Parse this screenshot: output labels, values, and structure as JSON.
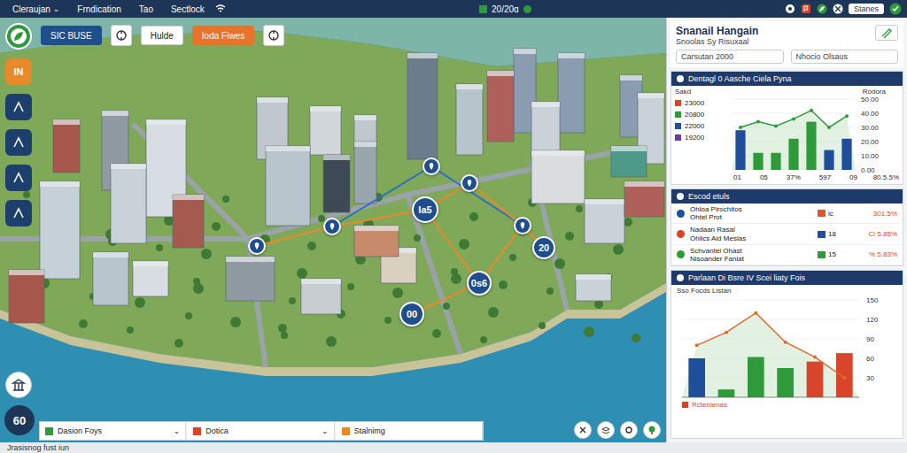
{
  "top_bar": {
    "menus": [
      {
        "label": "Cleraujan",
        "icon": "⌄"
      },
      {
        "label": "Frndication"
      },
      {
        "label": "Tao"
      },
      {
        "label": "Sectlock"
      }
    ],
    "date": "20/20ɑ",
    "user": "Stanes"
  },
  "map_toolbar": [
    {
      "kind": "primary",
      "label": "SIC BUSE"
    },
    {
      "kind": "icon"
    },
    {
      "kind": "plain",
      "label": "Hulde"
    },
    {
      "kind": "accent",
      "label": "Ioda Fiwes"
    },
    {
      "kind": "icon"
    }
  ],
  "left_tools": [
    {
      "kind": "icon"
    },
    {
      "kind": "text",
      "label": "IN"
    },
    {
      "kind": "icon"
    },
    {
      "kind": "icon"
    },
    {
      "kind": "icon"
    },
    {
      "kind": "icon"
    }
  ],
  "markers": [
    {
      "kind": "text",
      "label": "Ia5"
    },
    {
      "kind": "text",
      "label": "20"
    },
    {
      "kind": "text",
      "label": "0s6"
    },
    {
      "kind": "text",
      "label": "00"
    },
    {
      "kind": "icon"
    },
    {
      "kind": "icon"
    },
    {
      "kind": "icon"
    },
    {
      "kind": "icon"
    },
    {
      "kind": "icon"
    }
  ],
  "zoom_badge": "60",
  "bottom_bar": [
    {
      "label": "Dasion Foys",
      "icon": "⌄"
    },
    {
      "label": "Dotica",
      "icon": "⌄"
    },
    {
      "label": "Stalnimg"
    }
  ],
  "status_bar": "Jrasisnog fust iun",
  "panel": {
    "title": "Snanail Hangain",
    "subtitle": "Snoolas Sy Risuxaal",
    "fields": [
      "Carsutan 2000",
      "Nhocio Olsaus"
    ],
    "chart1": {
      "title": "Dentagl 0 Aasche Ciela Pyna",
      "legend_title": "Sakd",
      "legend": [
        {
          "label": "23000",
          "color": "#d9452b"
        },
        {
          "label": "20800",
          "color": "#2e9a3a"
        },
        {
          "label": "22000",
          "color": "#1f4e9a"
        },
        {
          "label": "19200",
          "color": "#6a3d9a"
        }
      ],
      "axis_title": "Rodora",
      "y_ticks": [
        "50.00",
        "40.00",
        "30.00",
        "20.00",
        "10.00",
        "0.00"
      ],
      "bars": [
        {
          "value": 28,
          "color": "#1f4e9a"
        },
        {
          "value": 12,
          "color": "#2e9a3a"
        },
        {
          "value": 12,
          "color": "#2e9a3a"
        },
        {
          "value": 22,
          "color": "#2e9a3a"
        },
        {
          "value": 34,
          "color": "#2e9a3a"
        },
        {
          "value": 14,
          "color": "#1f4e9a"
        },
        {
          "value": 22,
          "color": "#1f4e9a"
        }
      ],
      "line": [
        30,
        34,
        31,
        36,
        42,
        30,
        38
      ],
      "x_labels": [
        "01",
        "05",
        "37%",
        "597",
        "09"
      ],
      "total": "80.5.5%"
    },
    "table": {
      "title": "Escod etuls",
      "rows": [
        {
          "name": "Ohloa Pirochitos",
          "sub": "Ohtel Prot",
          "color": "#1f4e9a",
          "tag": "lc",
          "tag_color": "#e0542a",
          "percent": "301.5%"
        },
        {
          "name": "Nadaan Rasal",
          "sub": "Ohlics Aid Meslas",
          "color": "#d9452b",
          "tag": "18",
          "tag_color": "#1f4e9a",
          "percent": "Ci 5.85%"
        },
        {
          "name": "Schvantel Ohast",
          "sub": "Nisoander Faniat",
          "color": "#2e9a3a",
          "tag": "15",
          "tag_color": "#2e9a3a",
          "percent": "% 5.83%"
        }
      ]
    },
    "chart2": {
      "title": "Parlaan Di Bsre IV Scei liaty Fois",
      "subtitle": "Sso Focds Listan",
      "y_ticks": [
        "150",
        "120",
        "90",
        "60",
        "30"
      ],
      "bars": [
        {
          "value": 60,
          "color": "#1f4e9a"
        },
        {
          "value": 12,
          "color": "#2e9a3a"
        },
        {
          "value": 62,
          "color": "#2e9a3a"
        },
        {
          "value": 45,
          "color": "#2e9a3a"
        },
        {
          "value": 55,
          "color": "#d9452b"
        },
        {
          "value": 68,
          "color": "#d9452b"
        }
      ],
      "line": [
        80,
        100,
        130,
        85,
        62,
        30
      ],
      "legend": {
        "label": "Rctenlenas",
        "color": "#d9452b"
      }
    }
  }
}
